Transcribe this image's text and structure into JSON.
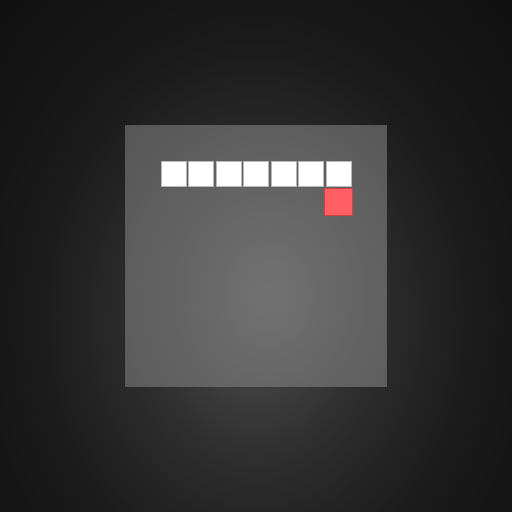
{
  "game": {
    "grid_columns": 10,
    "grid_rows": 10,
    "snake": [
      {
        "col": 1,
        "row": 1
      },
      {
        "col": 2,
        "row": 1
      },
      {
        "col": 3,
        "row": 1
      },
      {
        "col": 4,
        "row": 1
      },
      {
        "col": 5,
        "row": 1
      },
      {
        "col": 6,
        "row": 1
      },
      {
        "col": 7,
        "row": 1
      }
    ],
    "food": {
      "col": 7,
      "row": 2
    },
    "colors": {
      "snake": "#ffffff",
      "food": "#ff5f63",
      "board": "#666666",
      "background": "#1a1a1a"
    }
  }
}
